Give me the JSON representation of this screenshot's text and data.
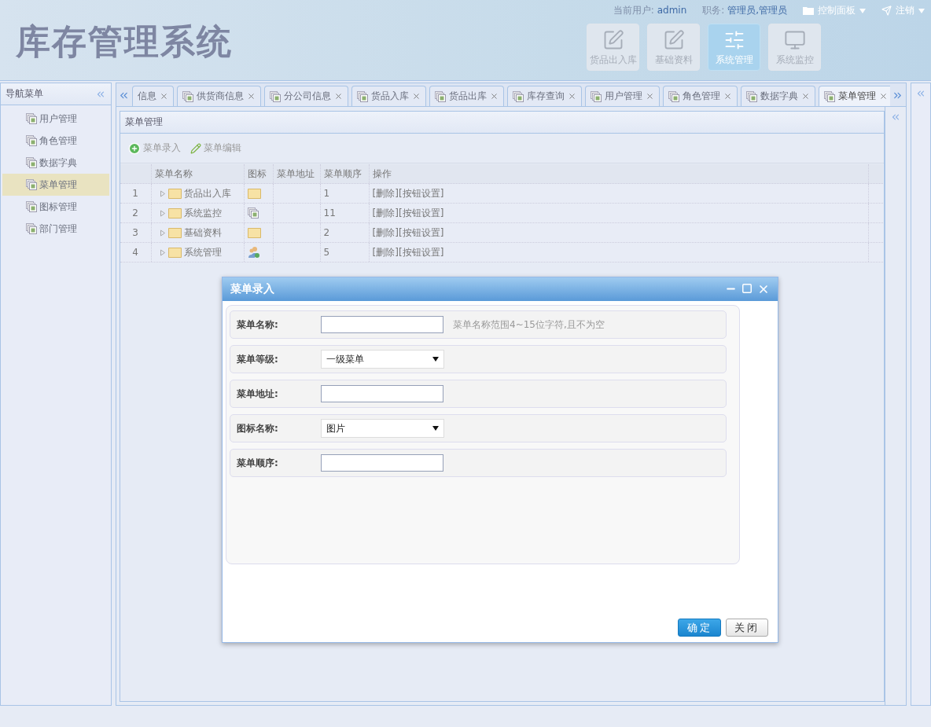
{
  "header": {
    "title": "库存管理系统",
    "user": {
      "label": "当前用户:",
      "value": "admin"
    },
    "role": {
      "label": "职务:",
      "value": "管理员,管理员"
    },
    "menus": [
      {
        "label": "控制面板",
        "kind": "panel"
      },
      {
        "label": "注销",
        "kind": "logout"
      }
    ],
    "modules": [
      {
        "label": "货品出入库",
        "kind": "edit",
        "selected": false
      },
      {
        "label": "基础资料",
        "kind": "edit",
        "selected": false
      },
      {
        "label": "系统管理",
        "kind": "settings",
        "selected": true
      },
      {
        "label": "系统监控",
        "kind": "monitor",
        "selected": false
      }
    ]
  },
  "sidebar": {
    "title": "导航菜单",
    "items": [
      {
        "label": "用户管理",
        "selected": false
      },
      {
        "label": "角色管理",
        "selected": false
      },
      {
        "label": "数据字典",
        "selected": false
      },
      {
        "label": "菜单管理",
        "selected": true
      },
      {
        "label": "图标管理",
        "selected": false
      },
      {
        "label": "部门管理",
        "selected": false
      }
    ]
  },
  "tabs": [
    {
      "label": "信息",
      "selected": false
    },
    {
      "label": "供货商信息",
      "selected": false
    },
    {
      "label": "分公司信息",
      "selected": false
    },
    {
      "label": "货品入库",
      "selected": false
    },
    {
      "label": "货品出库",
      "selected": false
    },
    {
      "label": "库存查询",
      "selected": false
    },
    {
      "label": "用户管理",
      "selected": false
    },
    {
      "label": "角色管理",
      "selected": false
    },
    {
      "label": "数据字典",
      "selected": false
    },
    {
      "label": "菜单管理",
      "selected": true
    }
  ],
  "panel": {
    "title": "菜单管理",
    "toolbar": [
      {
        "label": "菜单录入",
        "kind": "add"
      },
      {
        "label": "菜单编辑",
        "kind": "edit"
      }
    ],
    "table": {
      "columns": [
        "菜单名称",
        "图标",
        "菜单地址",
        "菜单顺序",
        "操作"
      ],
      "rows": [
        {
          "index": "1",
          "name": "货品出入库",
          "kind": "folder",
          "order": "1",
          "actions": "[删除][按钮设置]"
        },
        {
          "index": "2",
          "name": "系统监控",
          "kind": "pages",
          "order": "11",
          "actions": "[删除][按钮设置]"
        },
        {
          "index": "3",
          "name": "基础资料",
          "kind": "folder",
          "order": "2",
          "actions": "[删除][按钮设置]"
        },
        {
          "index": "4",
          "name": "系统管理",
          "kind": "users",
          "order": "5",
          "actions": "[删除][按钮设置]"
        }
      ]
    }
  },
  "dialog": {
    "title": "菜单录入",
    "fields": [
      {
        "label": "菜单名称:",
        "kind": "text",
        "hint": "菜单名称范围4~15位字符,且不为空"
      },
      {
        "label": "菜单等级:",
        "kind": "select",
        "value": "一级菜单"
      },
      {
        "label": "菜单地址:",
        "kind": "text"
      },
      {
        "label": "图标名称:",
        "kind": "select",
        "value": "图片"
      },
      {
        "label": "菜单顺序:",
        "kind": "text"
      }
    ],
    "buttons": [
      {
        "label": "确定",
        "kind": "primary"
      },
      {
        "label": "关闭",
        "kind": "default"
      }
    ]
  }
}
